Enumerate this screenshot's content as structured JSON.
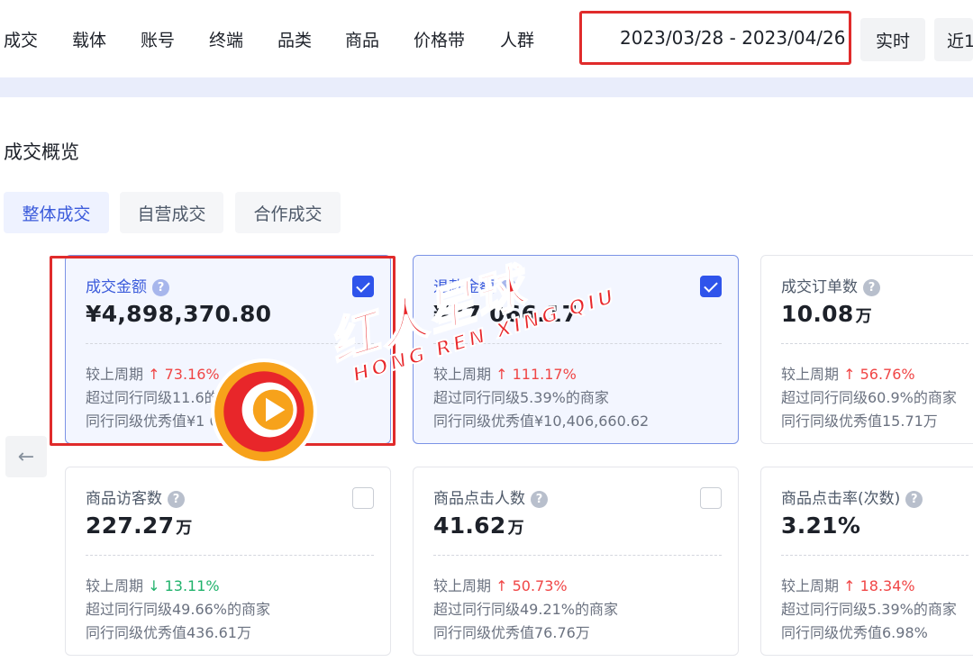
{
  "nav": {
    "items": [
      "成交",
      "载体",
      "账号",
      "终端",
      "品类",
      "商品",
      "价格带",
      "人群"
    ],
    "date_range": "2023/03/28 - 2023/04/26",
    "realtime_label": "实时",
    "recent_label": "近1"
  },
  "section": {
    "title": "成交概览",
    "tabs": [
      "整体成交",
      "自营成交",
      "合作成交"
    ],
    "active_tab": "整体成交"
  },
  "cards": [
    {
      "title": "成交金额",
      "value": "¥4,898,370.80",
      "unit": "",
      "checked": true,
      "compare_label": "较上周期",
      "trend": "up",
      "change": "73.16%",
      "peer_text": "超过同行同级11.6的商家",
      "excellent_text": "同行同级优秀值¥1 01,68.6"
    },
    {
      "title": "退款金额",
      "value": "¥77 066.17",
      "unit": "",
      "checked": true,
      "compare_label": "较上周期",
      "trend": "up",
      "change": "111.17%",
      "peer_text": "超过同行同级5.39%的商家",
      "excellent_text": "同行同级优秀值¥10,406,660.62"
    },
    {
      "title": "成交订单数",
      "value": "10.08",
      "unit": "万",
      "checked": null,
      "compare_label": "较上周期",
      "trend": "up",
      "change": "56.76%",
      "peer_text": "超过同行同级60.9%的商家",
      "excellent_text": "同行同级优秀值15.71万"
    },
    {
      "title": "商品访客数",
      "value": "227.27",
      "unit": "万",
      "checked": false,
      "compare_label": "较上周期",
      "trend": "down",
      "change": "13.11%",
      "peer_text": "超过同行同级49.66%的商家",
      "excellent_text": "同行同级优秀值436.61万"
    },
    {
      "title": "商品点击人数",
      "value": "41.62",
      "unit": "万",
      "checked": false,
      "compare_label": "较上周期",
      "trend": "up",
      "change": "50.73%",
      "peer_text": "超过同行同级49.21%的商家",
      "excellent_text": "同行同级优秀值76.76万"
    },
    {
      "title": "商品点击率(次数)",
      "value": "3.21%",
      "unit": "",
      "checked": null,
      "compare_label": "较上周期",
      "trend": "up",
      "change": "18.34%",
      "peer_text": "超过同行同级5.39%的商家",
      "excellent_text": "同行同级优秀值6.98%"
    }
  ],
  "watermark": {
    "text_cn": "红人星球",
    "text_en": "HONG REN XING QIU"
  },
  "colors": {
    "accent": "#2f54eb",
    "up": "#f04545",
    "down": "#20b26b",
    "highlight": "#e02b2b"
  },
  "icons": {
    "help": "question-circle-icon",
    "checkbox": "checkbox-icon",
    "back": "arrow-left-icon",
    "trend_up": "arrow-up-icon",
    "trend_down": "arrow-down-icon"
  }
}
